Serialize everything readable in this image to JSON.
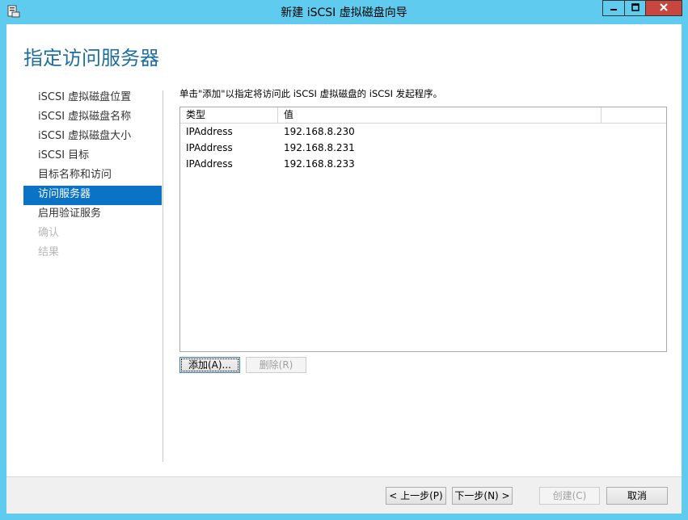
{
  "window": {
    "title": "新建 iSCSI 虚拟磁盘向导",
    "controls": {
      "minimize": "minimize-icon",
      "maximize": "maximize-icon",
      "close": "close-icon"
    }
  },
  "page": {
    "title": "指定访问服务器",
    "instruction": "单击\"添加\"以指定将访问此 iSCSI 虚拟磁盘的 iSCSI 发起程序。"
  },
  "nav": {
    "items": [
      {
        "label": "iSCSI 虚拟磁盘位置",
        "state": "normal"
      },
      {
        "label": "iSCSI 虚拟磁盘名称",
        "state": "normal"
      },
      {
        "label": "iSCSI 虚拟磁盘大小",
        "state": "normal"
      },
      {
        "label": "iSCSI 目标",
        "state": "normal"
      },
      {
        "label": "目标名称和访问",
        "state": "normal"
      },
      {
        "label": "访问服务器",
        "state": "active"
      },
      {
        "label": "启用验证服务",
        "state": "normal"
      },
      {
        "label": "确认",
        "state": "disabled"
      },
      {
        "label": "结果",
        "state": "disabled"
      }
    ]
  },
  "list": {
    "columns": [
      "类型",
      "值",
      ""
    ],
    "rows": [
      {
        "type": "IPAddress",
        "value": "192.168.8.230"
      },
      {
        "type": "IPAddress",
        "value": "192.168.8.231"
      },
      {
        "type": "IPAddress",
        "value": "192.168.8.233"
      }
    ]
  },
  "buttons": {
    "add": "添加(A)...",
    "remove": "删除(R)",
    "prev": "< 上一步(P)",
    "next": "下一步(N) >",
    "create": "创建(C)",
    "cancel": "取消"
  },
  "colors": {
    "frame": "#5fcbee",
    "accent": "#0a73c6",
    "title_text": "#1e6f9f",
    "close_button": "#c7463d"
  }
}
